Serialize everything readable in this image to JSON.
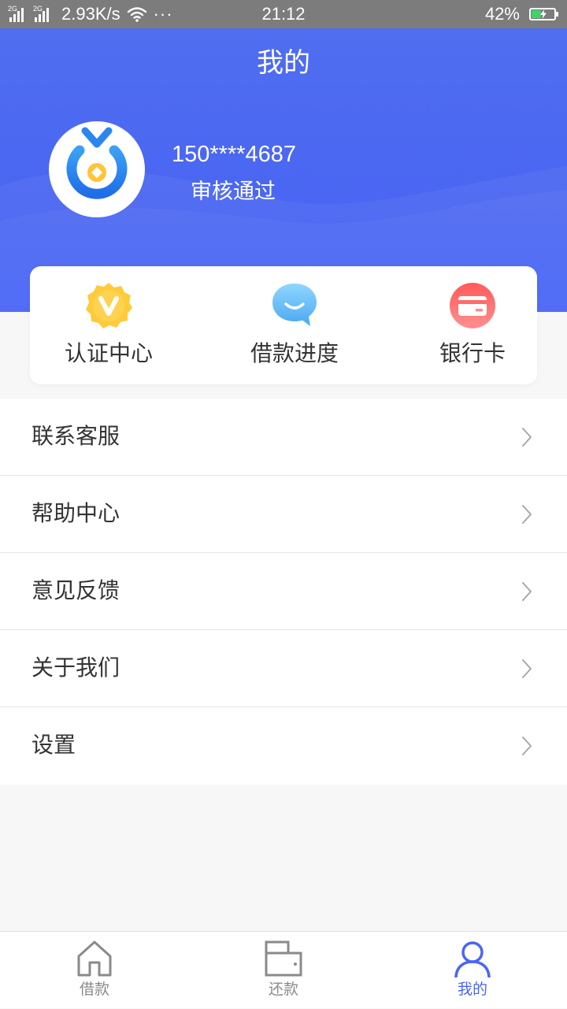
{
  "status_bar": {
    "signal_1_network": "2G",
    "signal_2_network": "2G",
    "net_speed": "2.93K/s",
    "more_indicator": "···",
    "time": "21:12",
    "battery_percent": "42%",
    "battery_level": 0.42,
    "icons": [
      "signal-icon",
      "wifi-icon",
      "battery-charging-icon"
    ]
  },
  "header": {
    "title": "我的",
    "avatar_icon": "app-logo-icon",
    "phone": "150****4687",
    "status": "审核通过"
  },
  "quick_actions": [
    {
      "label": "认证中心",
      "icon": "verify-badge-icon",
      "color": "#ffc93a"
    },
    {
      "label": "借款进度",
      "icon": "chat-bubble-icon",
      "color": "#5bbcf8"
    },
    {
      "label": "银行卡",
      "icon": "bank-card-icon",
      "color": "#ff6b6b"
    }
  ],
  "menu": [
    {
      "label": "联系客服"
    },
    {
      "label": "帮助中心"
    },
    {
      "label": "意见反馈"
    },
    {
      "label": "关于我们"
    },
    {
      "label": "设置"
    }
  ],
  "tabs": [
    {
      "label": "借款",
      "icon": "home-icon",
      "active": false
    },
    {
      "label": "还款",
      "icon": "wallet-icon",
      "active": false
    },
    {
      "label": "我的",
      "icon": "user-icon",
      "active": true
    }
  ],
  "colors": {
    "brand_blue": "#4a66f2",
    "status_bar": "#7c7c7c",
    "page_background": "#f7f7f8",
    "inactive_tab": "#8a8a8a"
  }
}
